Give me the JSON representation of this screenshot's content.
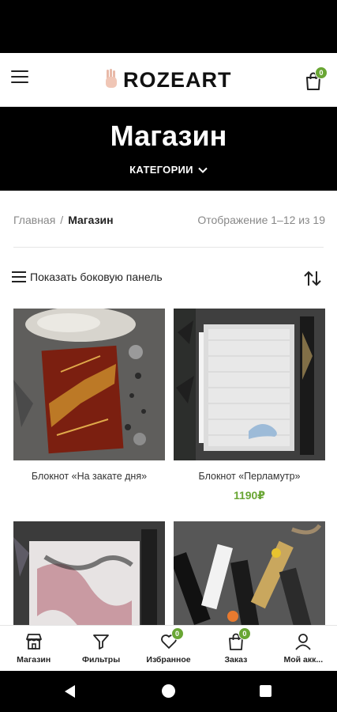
{
  "header": {
    "logo_text": "ROZEART",
    "cart_count": "0"
  },
  "hero": {
    "title": "Магазин",
    "categories_label": "КАТЕГОРИИ"
  },
  "breadcrumbs": {
    "home": "Главная",
    "separator": "/",
    "current": "Магазин"
  },
  "results_text": "Отображение 1–12 из 19",
  "toolbar": {
    "sidebar_label": "Показать боковую панель"
  },
  "products": [
    {
      "name": "Блокнот «На закате дня»",
      "price": ""
    },
    {
      "name": "Блокнот «Перламутр»",
      "price": "1190₽"
    },
    {
      "name": "",
      "price": ""
    },
    {
      "name": "",
      "price": ""
    }
  ],
  "bottom_nav": {
    "shop": "Магазин",
    "filters": "Фильтры",
    "wishlist": "Избранное",
    "wishlist_count": "0",
    "order": "Заказ",
    "order_count": "0",
    "account": "Мой акк..."
  },
  "colors": {
    "accent": "#69a634",
    "hero_bg": "#000000"
  }
}
